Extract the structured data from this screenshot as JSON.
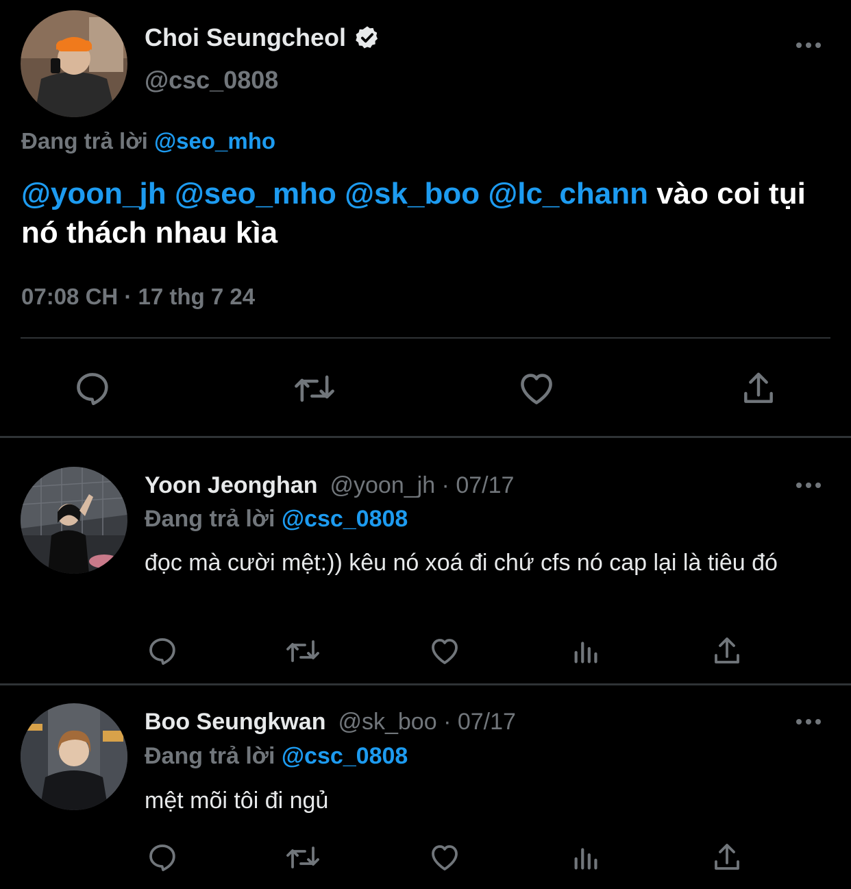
{
  "main_tweet": {
    "author_name": "Choi Seungcheol",
    "author_handle": "@csc_0808",
    "replying_prefix": "Đang trả lời",
    "replying_to": "@seo_mho",
    "mentions": [
      "@yoon_jh",
      "@seo_mho",
      "@sk_boo",
      "@lc_chann"
    ],
    "text_after_mentions": "vào coi tụi nó thách nhau kìa",
    "timestamp": "07:08 CH · 17 thg 7 24"
  },
  "replies": [
    {
      "author_name": "Yoon Jeonghan",
      "author_handle": "@yoon_jh · 07/17",
      "replying_prefix": "Đang trả lời",
      "replying_to": "@csc_0808",
      "text": "đọc mà cười mệt:)) kêu nó xoá đi chứ cfs nó cap lại là tiêu đó"
    },
    {
      "author_name": "Boo Seungkwan",
      "author_handle": "@sk_boo · 07/17",
      "replying_prefix": "Đang trả lời",
      "replying_to": "@csc_0808",
      "text": "mệt mõi tôi đi ngủ"
    }
  ],
  "icons": {
    "main_actions": [
      "reply-icon",
      "retweet-icon",
      "like-icon",
      "share-icon"
    ],
    "reply_actions": [
      "reply-icon",
      "retweet-icon",
      "like-icon",
      "views-icon",
      "share-icon"
    ]
  },
  "colors": {
    "background": "#000000",
    "text_primary": "#e7e9ea",
    "text_secondary": "#71767b",
    "link": "#1d9bf0",
    "divider": "#2f3336"
  }
}
